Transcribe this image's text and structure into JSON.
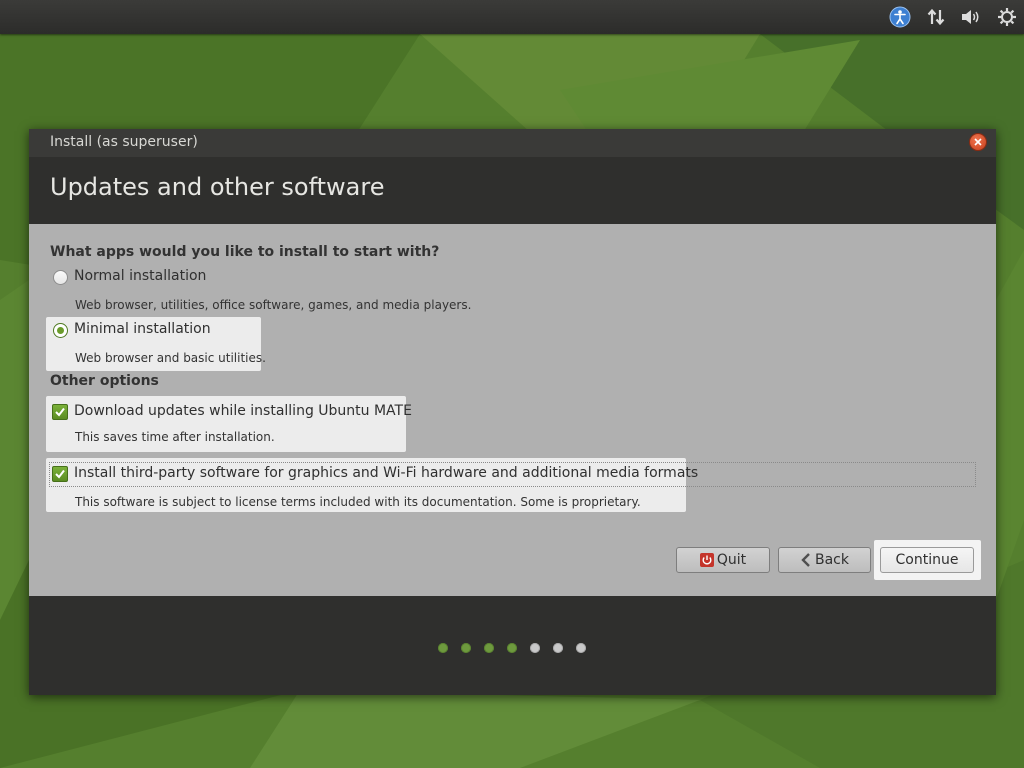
{
  "window": {
    "title": "Install (as superuser)",
    "page_title": "Updates and other software"
  },
  "apps_section": {
    "heading": "What apps would you like to install to start with?",
    "options": [
      {
        "label": "Normal installation",
        "description": "Web browser, utilities, office software, games, and media players.",
        "selected": false
      },
      {
        "label": "Minimal installation",
        "description": "Web browser and basic utilities.",
        "selected": true
      }
    ]
  },
  "other_options": {
    "heading": "Other options",
    "items": [
      {
        "label": "Download updates while installing Ubuntu MATE",
        "description": "This saves time after installation.",
        "checked": true
      },
      {
        "label": "Install third-party software for graphics and Wi-Fi hardware and additional media formats",
        "description": "This software is subject to license terms included with its documentation. Some is proprietary.",
        "checked": true
      }
    ]
  },
  "buttons": {
    "quit": "Quit",
    "back": "Back",
    "continue": "Continue"
  },
  "progress": {
    "total_steps": 7,
    "completed_steps": 4
  },
  "tray_icons": [
    "accessibility-icon",
    "network-icon",
    "volume-icon",
    "power-settings-icon"
  ],
  "colors": {
    "accent": "#6a9b2a",
    "header_bg": "#2f2f2d",
    "content_bg": "#b0b0b0"
  }
}
